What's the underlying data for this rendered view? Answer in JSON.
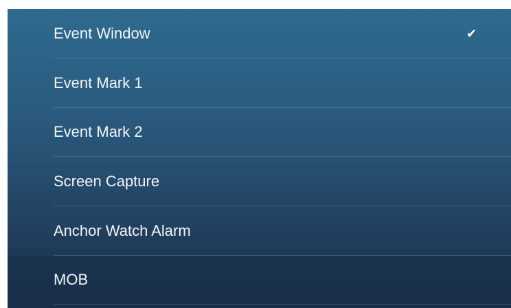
{
  "menu": {
    "items": [
      {
        "label": "Event Window",
        "checked": true
      },
      {
        "label": "Event Mark 1",
        "checked": false
      },
      {
        "label": "Event Mark 2",
        "checked": false
      },
      {
        "label": "Screen Capture",
        "checked": false
      },
      {
        "label": "Anchor Watch Alarm",
        "checked": false
      },
      {
        "label": "MOB",
        "checked": false
      }
    ],
    "check_glyph": "✔"
  }
}
